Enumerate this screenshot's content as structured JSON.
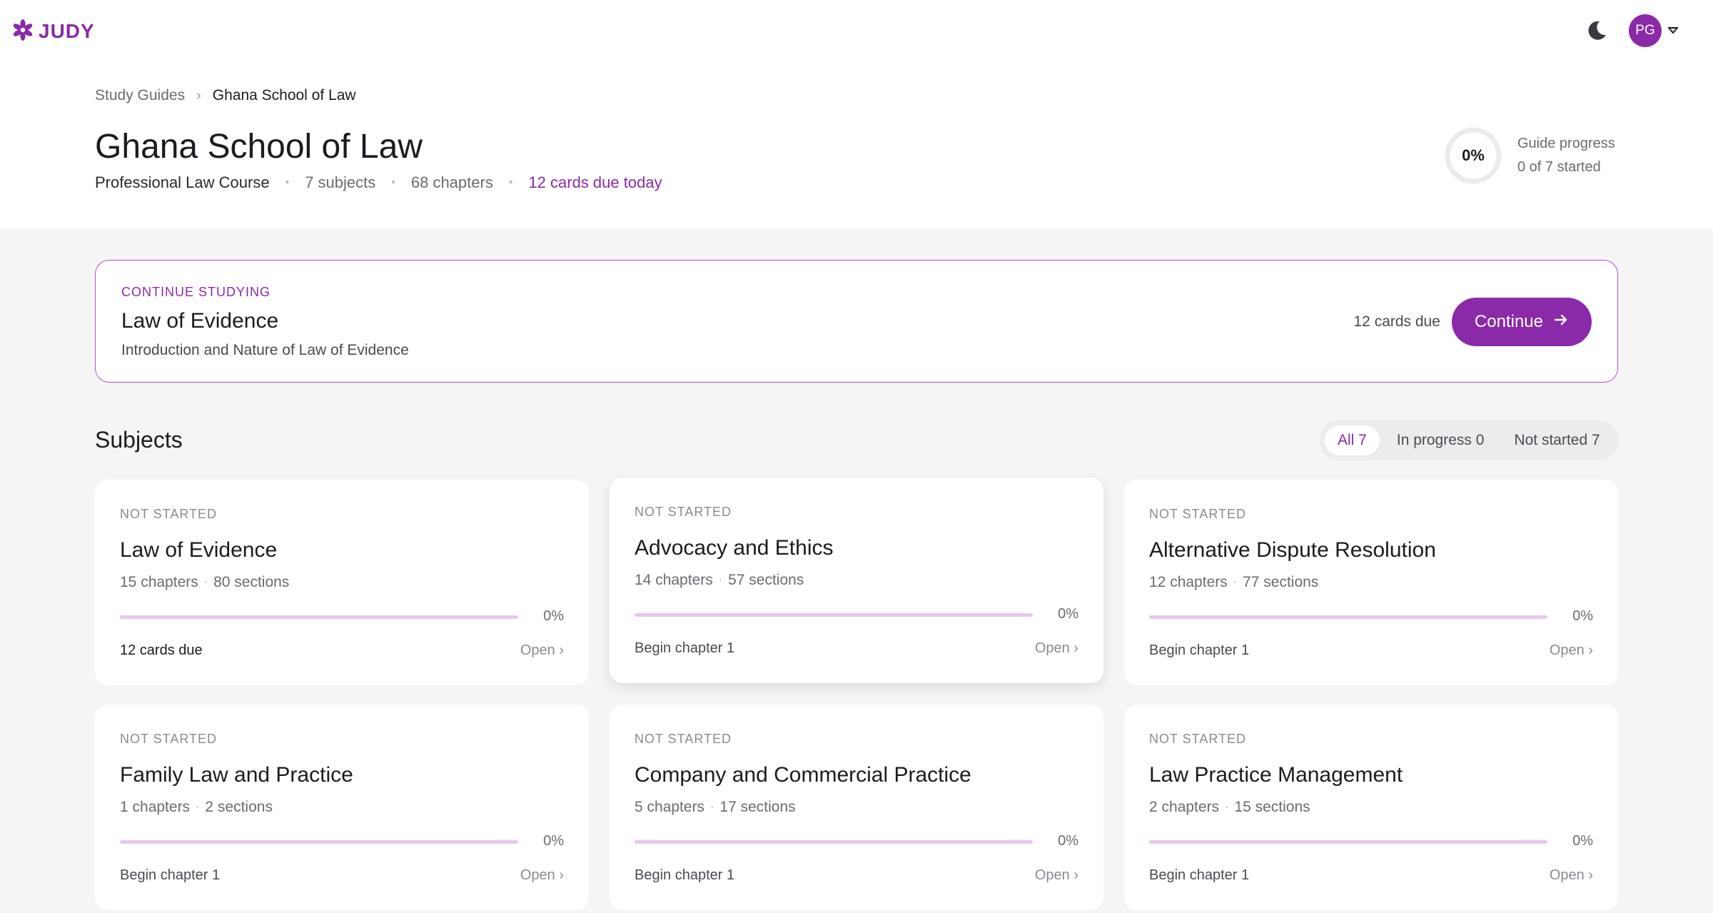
{
  "app": {
    "brand": "JUDY",
    "user_initials": "PG",
    "accent_color": "#8a2aa8",
    "icons": {
      "logo": "flower-icon",
      "theme": "moon-icon",
      "menu": "chevron-down-icon",
      "arrow": "arrow-right-icon"
    }
  },
  "breadcrumb": {
    "root": "Study Guides",
    "current": "Ghana School of Law"
  },
  "header": {
    "title": "Ghana School of Law",
    "course": "Professional Law Course",
    "subjects": "7 subjects",
    "chapters": "68 chapters",
    "due_today": "12 cards due today"
  },
  "guide_progress": {
    "percent_label": "0%",
    "percent_value": 0,
    "label": "Guide progress",
    "started": "0 of 7 started"
  },
  "continue": {
    "eyebrow": "CONTINUE STUDYING",
    "title": "Law of Evidence",
    "subtitle": "Introduction and Nature of Law of Evidence",
    "due": "12 cards due",
    "button": "Continue"
  },
  "subjects": {
    "heading": "Subjects",
    "filters": [
      "All 7",
      "In progress 0",
      "Not started 7"
    ],
    "cards": [
      {
        "status": "NOT STARTED",
        "title": "Law of Evidence",
        "chapters": "15 chapters",
        "sections": "80 sections",
        "percent": "0%",
        "progress": 0,
        "footer": "12 cards due",
        "open": "Open ›"
      },
      {
        "status": "NOT STARTED",
        "title": "Advocacy and Ethics",
        "chapters": "14 chapters",
        "sections": "57 sections",
        "percent": "0%",
        "progress": 0,
        "footer": "Begin chapter 1",
        "open": "Open ›"
      },
      {
        "status": "NOT STARTED",
        "title": "Alternative Dispute Resolution",
        "chapters": "12 chapters",
        "sections": "77 sections",
        "percent": "0%",
        "progress": 0,
        "footer": "Begin chapter 1",
        "open": "Open ›"
      },
      {
        "status": "NOT STARTED",
        "title": "Family Law and Practice",
        "chapters": "1 chapters",
        "sections": "2 sections",
        "percent": "0%",
        "progress": 0,
        "footer": "Begin chapter 1",
        "open": "Open ›"
      },
      {
        "status": "NOT STARTED",
        "title": "Company and Commercial Practice",
        "chapters": "5 chapters",
        "sections": "17 sections",
        "percent": "0%",
        "progress": 0,
        "footer": "Begin chapter 1",
        "open": "Open ›"
      },
      {
        "status": "NOT STARTED",
        "title": "Law Practice Management",
        "chapters": "2 chapters",
        "sections": "15 sections",
        "percent": "0%",
        "progress": 0,
        "footer": "Begin chapter 1",
        "open": "Open ›"
      }
    ]
  }
}
